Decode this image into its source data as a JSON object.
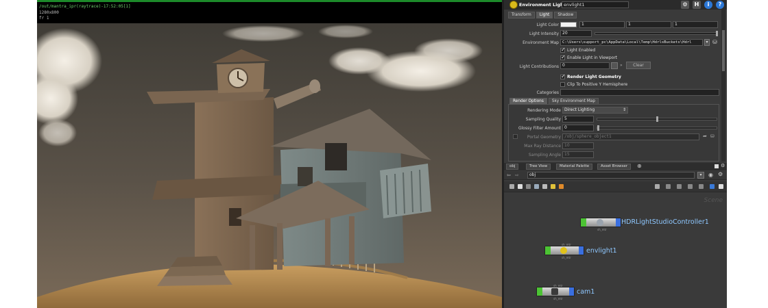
{
  "viewport": {
    "line1": "/out/mantra_ipr(raytrace)-17:52:05[1]",
    "line2": "1280x800",
    "line3": "fr 1"
  },
  "header": {
    "node_type": "Environment Light",
    "node_name": "envlight1",
    "icons": [
      "gear-icon",
      "help-h-icon",
      "info-icon",
      "question-icon"
    ]
  },
  "tabs": [
    "Transform",
    "Light",
    "Shadow"
  ],
  "params": {
    "light_color_label": "Light Color",
    "light_color_values": [
      "1",
      "1",
      "1"
    ],
    "light_intensity_label": "Light Intensity",
    "light_intensity_value": "20",
    "env_map_label": "Environment Map",
    "env_map_value": "C:\\Users\\support_pc\\AppData\\Local\\Temp\\HdrlsBuckets\\Hdrl",
    "light_enabled": "Light Enabled",
    "enable_in_viewport": "Enable Light in Viewport",
    "light_contrib_label": "Light Contributions",
    "light_contrib_value": "0",
    "clear_label": "Clear",
    "render_geometry": "Render Light Geometry",
    "clip_hemisphere": "Clip To Positive Y Hemisphere",
    "categories_label": "Categories"
  },
  "render_tabs": [
    "Render Options",
    "Sky Environment Map"
  ],
  "render_options": {
    "rendering_mode_label": "Rendering Mode",
    "rendering_mode_value": "Direct Lighting",
    "sampling_quality_label": "Sampling Quality",
    "sampling_quality_value": "5",
    "glossy_filter_label": "Glossy Filter Amount",
    "glossy_filter_value": "0",
    "portal_geometry_label": "Portal Geometry",
    "portal_geometry_value": "/obj/sphere_object1",
    "max_ray_label": "Max Ray Distance",
    "max_ray_value": "10",
    "sampling_angle_label": "Sampling Angle",
    "sampling_angle_value": "15"
  },
  "network_tabs": [
    "obj",
    "Tree View",
    "Material Palette",
    "Asset Browser"
  ],
  "network_path": "obj",
  "network_watermark": "Scene",
  "nodes": [
    {
      "label": "HDRLightStudioController1",
      "tiny": "sh_mtr",
      "icon_color": "#9aa3ad"
    },
    {
      "label": "envlight1",
      "tiny": "sh_mtr",
      "icon_color": "#e0c21a"
    },
    {
      "label": "cam1",
      "tiny": "sh_mtr",
      "icon_color": "#3a3a3a"
    }
  ],
  "colors": {
    "accent_green": "#4cc334",
    "accent_blue": "#3a6fe0",
    "panel_bg": "#3a3a3a",
    "node_label": "#8fc8ff"
  }
}
